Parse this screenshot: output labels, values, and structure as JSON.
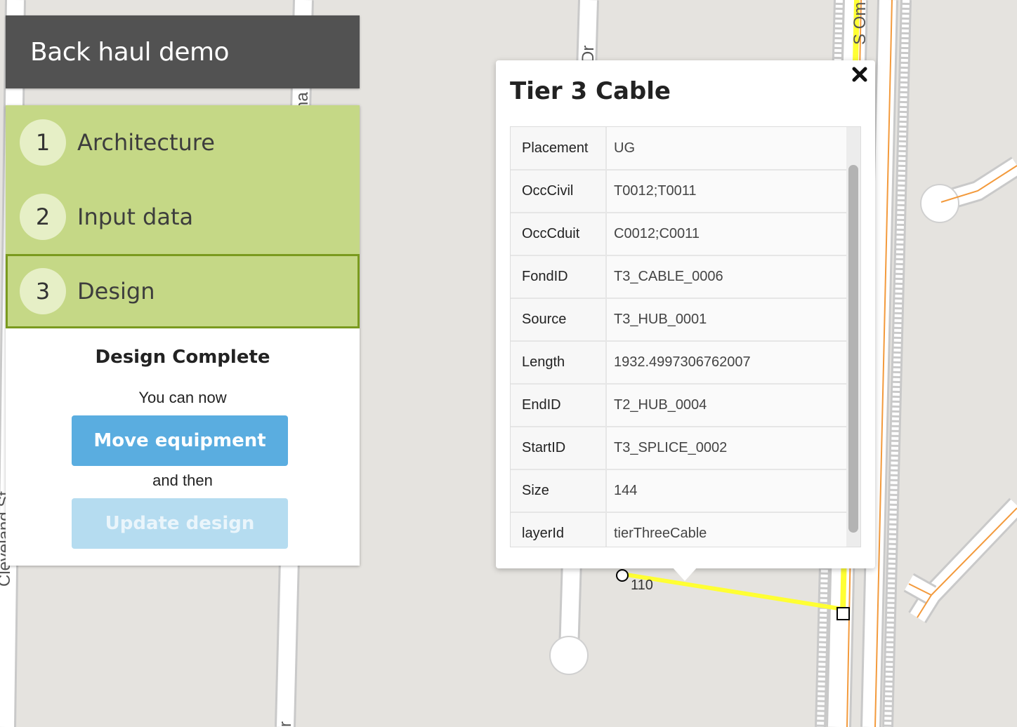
{
  "app": {
    "title": "Back haul demo"
  },
  "steps": [
    {
      "number": "1",
      "label": "Architecture",
      "state": "complete"
    },
    {
      "number": "2",
      "label": "Input data",
      "state": "complete"
    },
    {
      "number": "3",
      "label": "Design",
      "state": "active"
    }
  ],
  "design_status": {
    "title": "Design Complete",
    "line1": "You can now",
    "move_button": "Move equipment",
    "line2": "and then",
    "update_button": "Update design"
  },
  "popup": {
    "title": "Tier 3 Cable",
    "rows": [
      {
        "key": "Placement",
        "value": "UG"
      },
      {
        "key": "OccCivil",
        "value": "T0012;T0011"
      },
      {
        "key": "OccCduit",
        "value": "C0012;C0011"
      },
      {
        "key": "FondID",
        "value": "T3_CABLE_0006"
      },
      {
        "key": "Source",
        "value": "T3_HUB_0001"
      },
      {
        "key": "Length",
        "value": "1932.4997306762007"
      },
      {
        "key": "EndID",
        "value": "T2_HUB_0004"
      },
      {
        "key": "StartID",
        "value": "T3_SPLICE_0002"
      },
      {
        "key": "Size",
        "value": "144"
      },
      {
        "key": "layerId",
        "value": "tierThreeCable"
      }
    ]
  },
  "map": {
    "street_labels": [
      "Cleveland St",
      "Dr",
      "na",
      "S Om",
      "r"
    ],
    "marker_label": "110",
    "colors": {
      "background": "#e5e3df",
      "road": "#ffffff",
      "cable_yellow": "#ffff33",
      "cable_orange": "#f39a3c"
    }
  }
}
